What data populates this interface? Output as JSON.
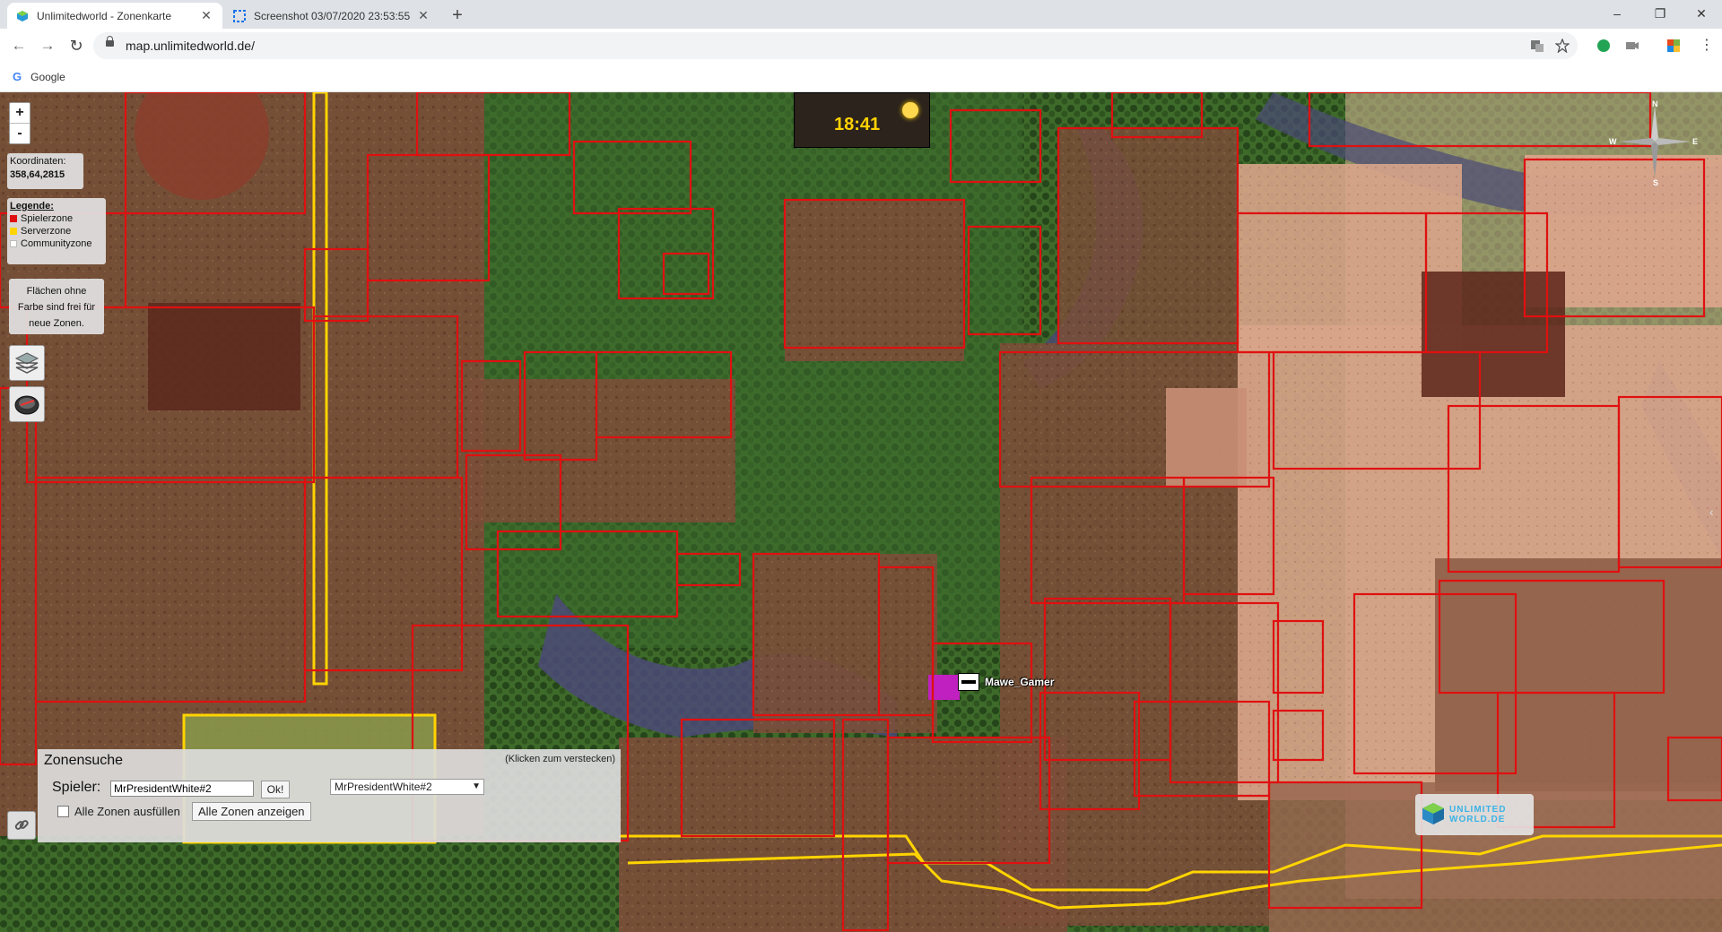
{
  "browser": {
    "tabs": [
      {
        "title": "Unlimitedworld - Zonenkarte",
        "active": true
      },
      {
        "title": "Screenshot 03/07/2020 23:53:55",
        "active": false
      }
    ],
    "new_tab_label": "+",
    "window_controls": {
      "minimize": "–",
      "maximize": "❐",
      "close": "✕"
    },
    "url": "map.unlimitedworld.de/",
    "bookmarks": [
      {
        "label": "Google"
      }
    ]
  },
  "map": {
    "zoom_in": "+",
    "zoom_out": "-",
    "coords_label": "Koordinaten:",
    "coords_value": "358,64,2815",
    "legend": {
      "title": "Legende:",
      "items": [
        {
          "label": "Spielerzone",
          "color": "#e01010"
        },
        {
          "label": "Serverzone",
          "color": "#ffd400"
        },
        {
          "label": "Communityzone",
          "color": "#ffffff"
        }
      ]
    },
    "free_info": "Flächen ohne Farbe sind frei für neue Zonen.",
    "time": "18:41",
    "compass": {
      "n": "N",
      "e": "E",
      "s": "S",
      "w": "W"
    },
    "player_marker": "Mawe_Gamer"
  },
  "zone_search": {
    "title": "Zonensuche",
    "hint": "(Klicken zum verstecken)",
    "player_label": "Spieler:",
    "player_value": "MrPresidentWhite#2",
    "ok_label": "Ok!",
    "select_value": "MrPresidentWhite#2",
    "fill_all_label": "Alle Zonen ausfüllen",
    "show_all_label": "Alle Zonen anzeigen"
  },
  "logo_text": "UNLIMITED WORLD.DE",
  "colors": {
    "zone_red": "#e01010",
    "zone_yellow": "#ffd400",
    "highlight": "#c020c0"
  }
}
